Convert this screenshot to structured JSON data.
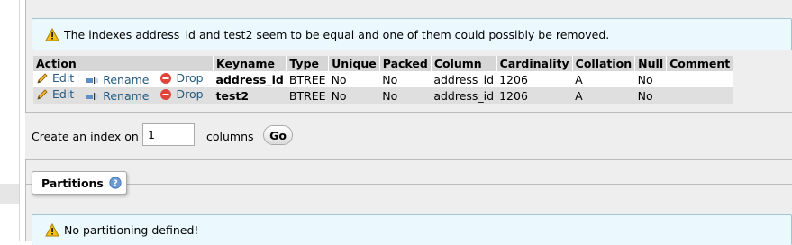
{
  "warning_notice": {
    "icon": "warning-icon",
    "text": "The indexes address_id and test2 seem to be equal and one of them could possibly be removed."
  },
  "indexes_table": {
    "headers": [
      "Action",
      "Keyname",
      "Type",
      "Unique",
      "Packed",
      "Column",
      "Cardinality",
      "Collation",
      "Null",
      "Comment"
    ],
    "action_labels": {
      "edit": "Edit",
      "rename": "Rename",
      "drop": "Drop"
    },
    "rows": [
      {
        "keyname": "address_id",
        "type": "BTREE",
        "unique": "No",
        "packed": "No",
        "column": "address_id",
        "cardinality": "1206",
        "collation": "A",
        "null": "No",
        "comment": ""
      },
      {
        "keyname": "test2",
        "type": "BTREE",
        "unique": "No",
        "packed": "No",
        "column": "address_id",
        "cardinality": "1206",
        "collation": "A",
        "null": "No",
        "comment": ""
      }
    ]
  },
  "create_index": {
    "label": "Create an index on",
    "value": "1",
    "columns_label": "columns",
    "go_label": "Go"
  },
  "partitions": {
    "legend": "Partitions",
    "help_icon": "help-icon",
    "notice_icon": "warning-icon",
    "notice": "No partitioning defined!"
  },
  "colors": {
    "link": "#235a81",
    "notice_bg": "#ebf8fd",
    "notice_border": "#a3c4d3",
    "drop_icon": "#e0443a",
    "warning_icon": "#f5c211"
  }
}
